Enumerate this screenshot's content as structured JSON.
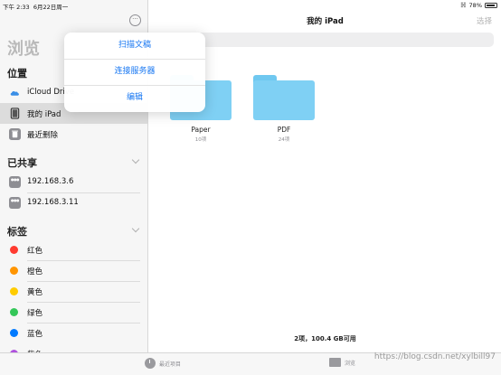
{
  "status_bar": {
    "time": "下午 2:33",
    "date": "6月22日周一",
    "battery": "78%",
    "icons": [
      "wifi-icon",
      "battery-icon"
    ]
  },
  "sidebar": {
    "title": "浏览",
    "more_label": "···",
    "locations": {
      "header": "位置",
      "items": [
        {
          "label": "iCloud Drive",
          "icon": "icloud-icon"
        },
        {
          "label": "我的 iPad",
          "icon": "ipad-icon",
          "selected": true
        },
        {
          "label": "最近删除",
          "icon": "trash-icon"
        }
      ]
    },
    "shared": {
      "header": "已共享",
      "items": [
        {
          "label": "192.168.3.6",
          "icon": "server-icon"
        },
        {
          "label": "192.168.3.11",
          "icon": "server-icon"
        }
      ]
    },
    "tags": {
      "header": "标签",
      "items": [
        {
          "label": "红色",
          "color": "#ff3b30"
        },
        {
          "label": "橙色",
          "color": "#ff9500"
        },
        {
          "label": "黄色",
          "color": "#ffcc00"
        },
        {
          "label": "绿色",
          "color": "#34c759"
        },
        {
          "label": "蓝色",
          "color": "#007aff"
        },
        {
          "label": "紫色",
          "color": "#af52de"
        }
      ]
    }
  },
  "popover": {
    "items": [
      "扫描文稿",
      "连接服务器",
      "编辑"
    ]
  },
  "main": {
    "title": "我的 iPad",
    "select_label": "选择",
    "folders": [
      {
        "name": "Paper",
        "count": "10项"
      },
      {
        "name": "PDF",
        "count": "24项"
      }
    ],
    "storage": "2项，100.4 GB可用"
  },
  "tabbar": {
    "recents": "最近项目",
    "browse": "浏览"
  },
  "watermark": "https://blog.csdn.net/xylbill97",
  "colors": {
    "accent": "#1877f2",
    "folder": "#7fd0f4"
  }
}
